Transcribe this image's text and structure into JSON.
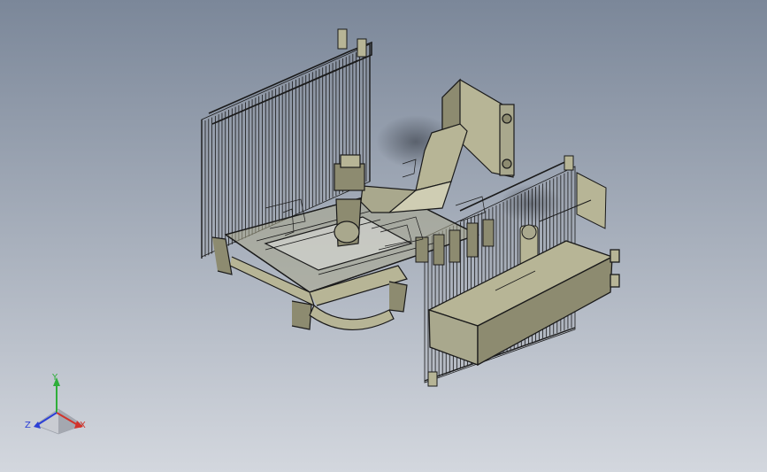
{
  "viewport": {
    "background_top": "#7b8799",
    "background_bottom": "#d3d7de",
    "line_color": "#1a1a1a",
    "part_fill": "#b7b596",
    "part_fill_dark": "#8d8b70",
    "part_fill_light": "#cfcdb3"
  },
  "triad": {
    "x_label": "X",
    "y_label": "Y",
    "z_label": "Z",
    "x_color": "#d2332b",
    "y_color": "#2fae3a",
    "z_color": "#2b3fd6"
  }
}
